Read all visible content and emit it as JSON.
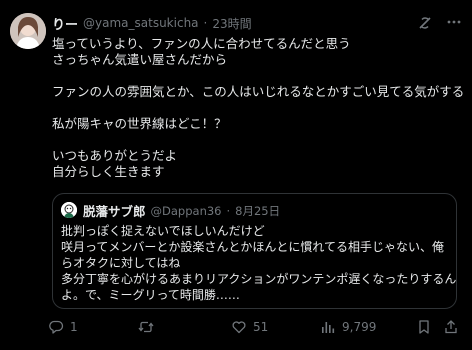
{
  "post": {
    "author_name": "りー",
    "handle": "@yama_satsukicha",
    "separator": "·",
    "time": "23時間",
    "lines": [
      "塩っていうより、ファンの人に合わせてるんだと思う",
      "さっちゃん気遣い屋さんだから",
      "",
      "ファンの人の雰囲気とか、この人はいじれるなとかすごい見てる気がする",
      "",
      "私が陽キャの世界線はどこ！？",
      "",
      "いつもありがとうだよ",
      "自分らしく生きます"
    ]
  },
  "quote": {
    "author_name": "脱藩サブ郎",
    "handle": "@Dappan36",
    "separator": "·",
    "date": "8月25日",
    "lines": [
      "批判っぽく捉えないでほしいんだけど",
      "咲月ってメンバーとか設楽さんとかほんとに慣れてる相手じゃない、俺",
      "らオタクに対してはね",
      "多分丁寧を心がけるあまりリアクションがワンテンポ遅くなったりするん",
      "よ。で、ミーグリって時間勝……"
    ]
  },
  "actions": {
    "reply_count": "1",
    "repost_count": "",
    "like_count": "51",
    "view_count": "9,799"
  },
  "icons": {
    "reply": "reply-icon",
    "repost": "repost-icon",
    "like": "heart-icon",
    "views": "views-icon",
    "bookmark": "bookmark-icon",
    "share": "share-icon",
    "grok": "grok-icon",
    "more": "more-icon"
  },
  "colors": {
    "background": "#000000",
    "text": "#e7e9ea",
    "muted": "#71767b",
    "border": "#2f3336"
  }
}
